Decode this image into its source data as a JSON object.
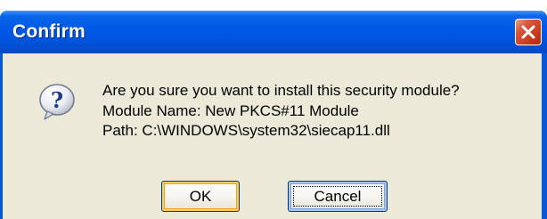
{
  "dialog": {
    "title": "Confirm",
    "message_lines": [
      "Are you sure you want to install this security module?",
      "Module Name: New PKCS#11 Module",
      "Path: C:\\WINDOWS\\system32\\siecap11.dll"
    ],
    "icon": "question-icon",
    "buttons": {
      "ok_label": "OK",
      "cancel_label": "Cancel"
    }
  },
  "colors": {
    "titlebar": "#0058E6",
    "dialog_background": "#ECE9D8",
    "close_button": "#C6391C"
  }
}
